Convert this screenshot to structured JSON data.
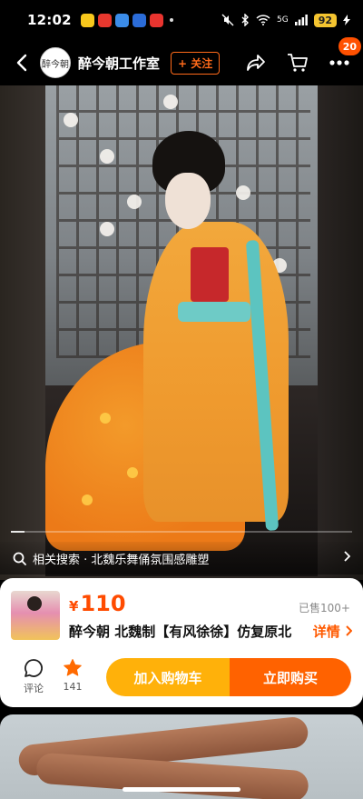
{
  "status_bar": {
    "time": "12:02",
    "signal_label": "5G",
    "battery": "92",
    "app_colors": [
      "#f8c81c",
      "#e8382e",
      "#3b8ce8",
      "#2b6cd8",
      "#e9342f"
    ]
  },
  "nav": {
    "shop_name": "醉今朝工作室",
    "avatar_text": "醉今朝",
    "follow_label": "+ 关注",
    "badge_count": "20"
  },
  "hero": {
    "related_search": "相关搜索 · 北魏乐舞俑氛围感雕塑",
    "progress": 0.0
  },
  "product": {
    "currency": "¥",
    "price": "110",
    "sold": "已售100+",
    "title": "醉今朝 北魏制【有风徐徐】仿复原北",
    "detail_label": "详情"
  },
  "actions": {
    "comment_label": "评论",
    "fav_count": "141",
    "cart_label": "加入购物车",
    "buy_label": "立即购买"
  },
  "colors": {
    "accent": "#ff5000",
    "cart": "#ffb10a",
    "buy": "#ff6200",
    "price": "#ff4b00"
  }
}
